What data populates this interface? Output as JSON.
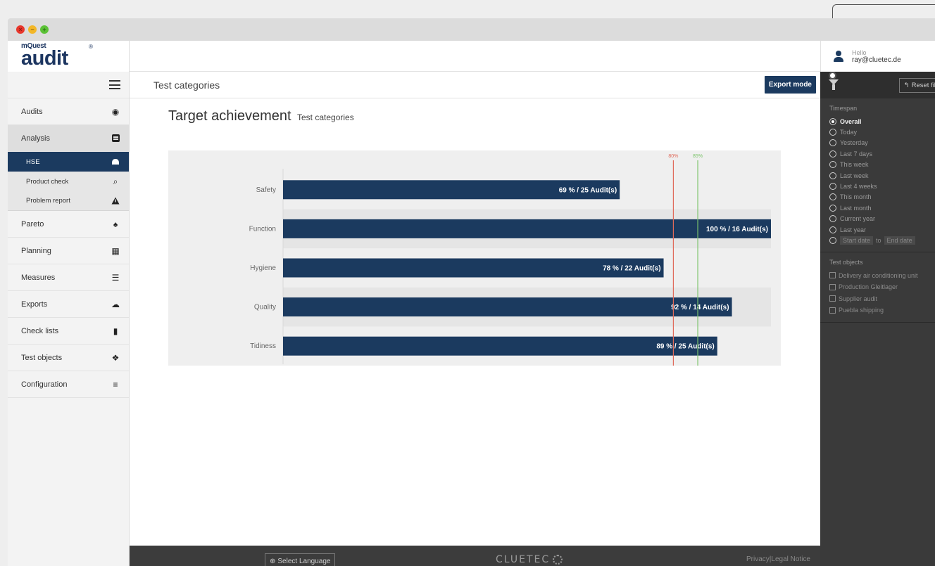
{
  "app": {
    "logo_small": "mQuest",
    "logo_big": "audit",
    "logo_reg": "®"
  },
  "sidebar": {
    "items": [
      {
        "label": "Audits",
        "icon": "globe-icon"
      },
      {
        "label": "Analysis",
        "icon": "report-icon",
        "active": true
      },
      {
        "label": "Pareto",
        "icon": "trophy-icon"
      },
      {
        "label": "Planning",
        "icon": "calendar-icon"
      },
      {
        "label": "Measures",
        "icon": "tasks-icon"
      },
      {
        "label": "Exports",
        "icon": "cloud-download-icon"
      },
      {
        "label": "Check lists",
        "icon": "clipboard-icon"
      },
      {
        "label": "Test objects",
        "icon": "cubes-icon"
      },
      {
        "label": "Configuration",
        "icon": "database-icon"
      }
    ],
    "analysis_sub": [
      {
        "label": "HSE",
        "icon": "hardhat-icon",
        "selected": true
      },
      {
        "label": "Product check",
        "icon": "search-icon"
      },
      {
        "label": "Problem report",
        "icon": "warning-icon"
      }
    ]
  },
  "main": {
    "section_title": "Test categories",
    "export_label": "Export mode",
    "heading": "Target achievement",
    "heading_sub": "Test categories"
  },
  "chart_data": {
    "type": "bar",
    "orientation": "horizontal",
    "categories": [
      "Safety",
      "Function",
      "Hygiene",
      "Quality",
      "Tidiness"
    ],
    "values": [
      69,
      100,
      78,
      92,
      89
    ],
    "audits": [
      25,
      16,
      22,
      14,
      25
    ],
    "labels": [
      "69 % / 25 Audit(s)",
      "100 % / 16 Audit(s)",
      "78 % / 22 Audit(s)",
      "92 % / 14 Audit(s)",
      "89 % / 25 Audit(s)"
    ],
    "xlim": [
      0,
      100
    ],
    "targets": [
      {
        "label": "80%",
        "value": 80,
        "color": "#e06a5a"
      },
      {
        "label": "85%",
        "value": 85,
        "color": "#7cc46b"
      }
    ],
    "bar_color": "#1b3a5f",
    "grid": false
  },
  "footer": {
    "language_label": "Select Language",
    "brand": "CLUETEC",
    "privacy": "Privacy",
    "separator": "|",
    "legal": "Legal Notice"
  },
  "panel": {
    "hello": "Hello",
    "email": "ray@cluetec.de",
    "reset_label": "Reset filter",
    "timespan_title": "Timespan",
    "timespan_options": [
      "Overall",
      "Today",
      "Yesterday",
      "Last 7 days",
      "This week",
      "Last week",
      "Last 4 weeks",
      "This month",
      "Last month",
      "Current year",
      "Last year"
    ],
    "timespan_selected": "Overall",
    "start_date_placeholder": "Start date",
    "to_label": "to",
    "end_date_placeholder": "End date",
    "objects_title": "Test objects",
    "objects": [
      "Delivery air conditioning unit",
      "Production Gleitlager",
      "Supplier audit",
      "Puebla shipping"
    ]
  }
}
